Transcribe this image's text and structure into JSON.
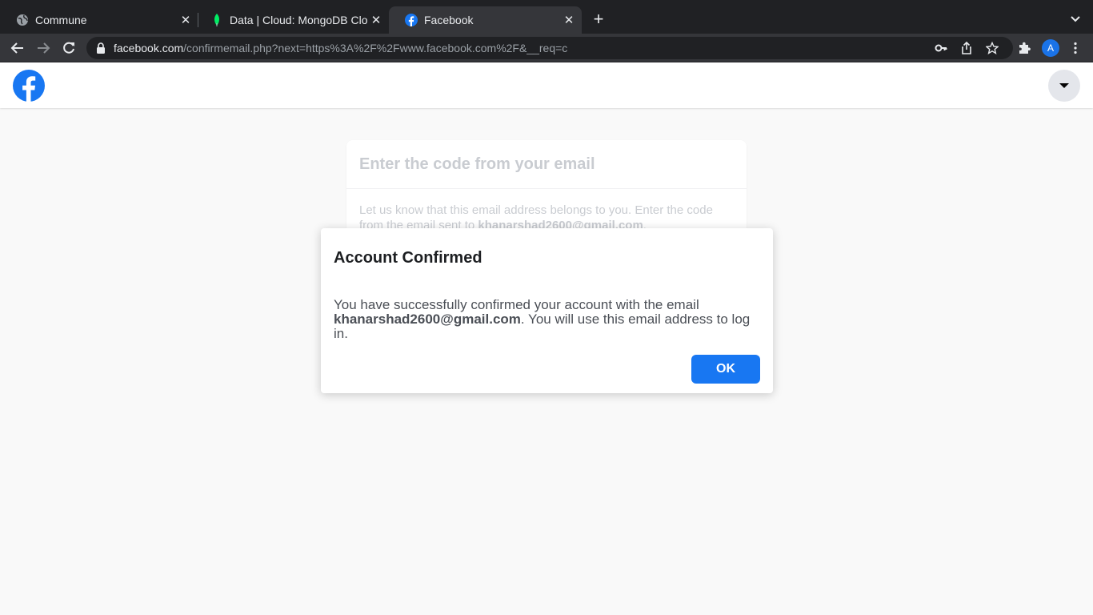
{
  "browser": {
    "tabs": [
      {
        "title": "Commune",
        "icon": "globe-icon",
        "active": false
      },
      {
        "title": "Data | Cloud: MongoDB Cloud",
        "icon": "mongodb-leaf-icon",
        "active": false
      },
      {
        "title": "Facebook",
        "icon": "facebook-icon",
        "active": true
      }
    ],
    "url_host": "facebook.com",
    "url_path": "/confirmemail.php?next=https%3A%2F%2Fwww.facebook.com%2F&__req=c",
    "profile_initial": "A",
    "accent_color": "#1a73e8"
  },
  "page": {
    "brand_color": "#1877f2",
    "background_card": {
      "heading": "Enter the code from your email",
      "body_prefix": "Let us know that this email address belongs to you. Enter the code from the email sent to ",
      "email": "khanarshad2600@gmail.com",
      "body_suffix": "."
    },
    "dialog": {
      "title": "Account Confirmed",
      "body_prefix": "You have successfully confirmed your account with the email ",
      "email": "khanarshad2600@gmail.com",
      "body_suffix": ". You will use this email address to log in.",
      "ok_label": "OK"
    }
  }
}
